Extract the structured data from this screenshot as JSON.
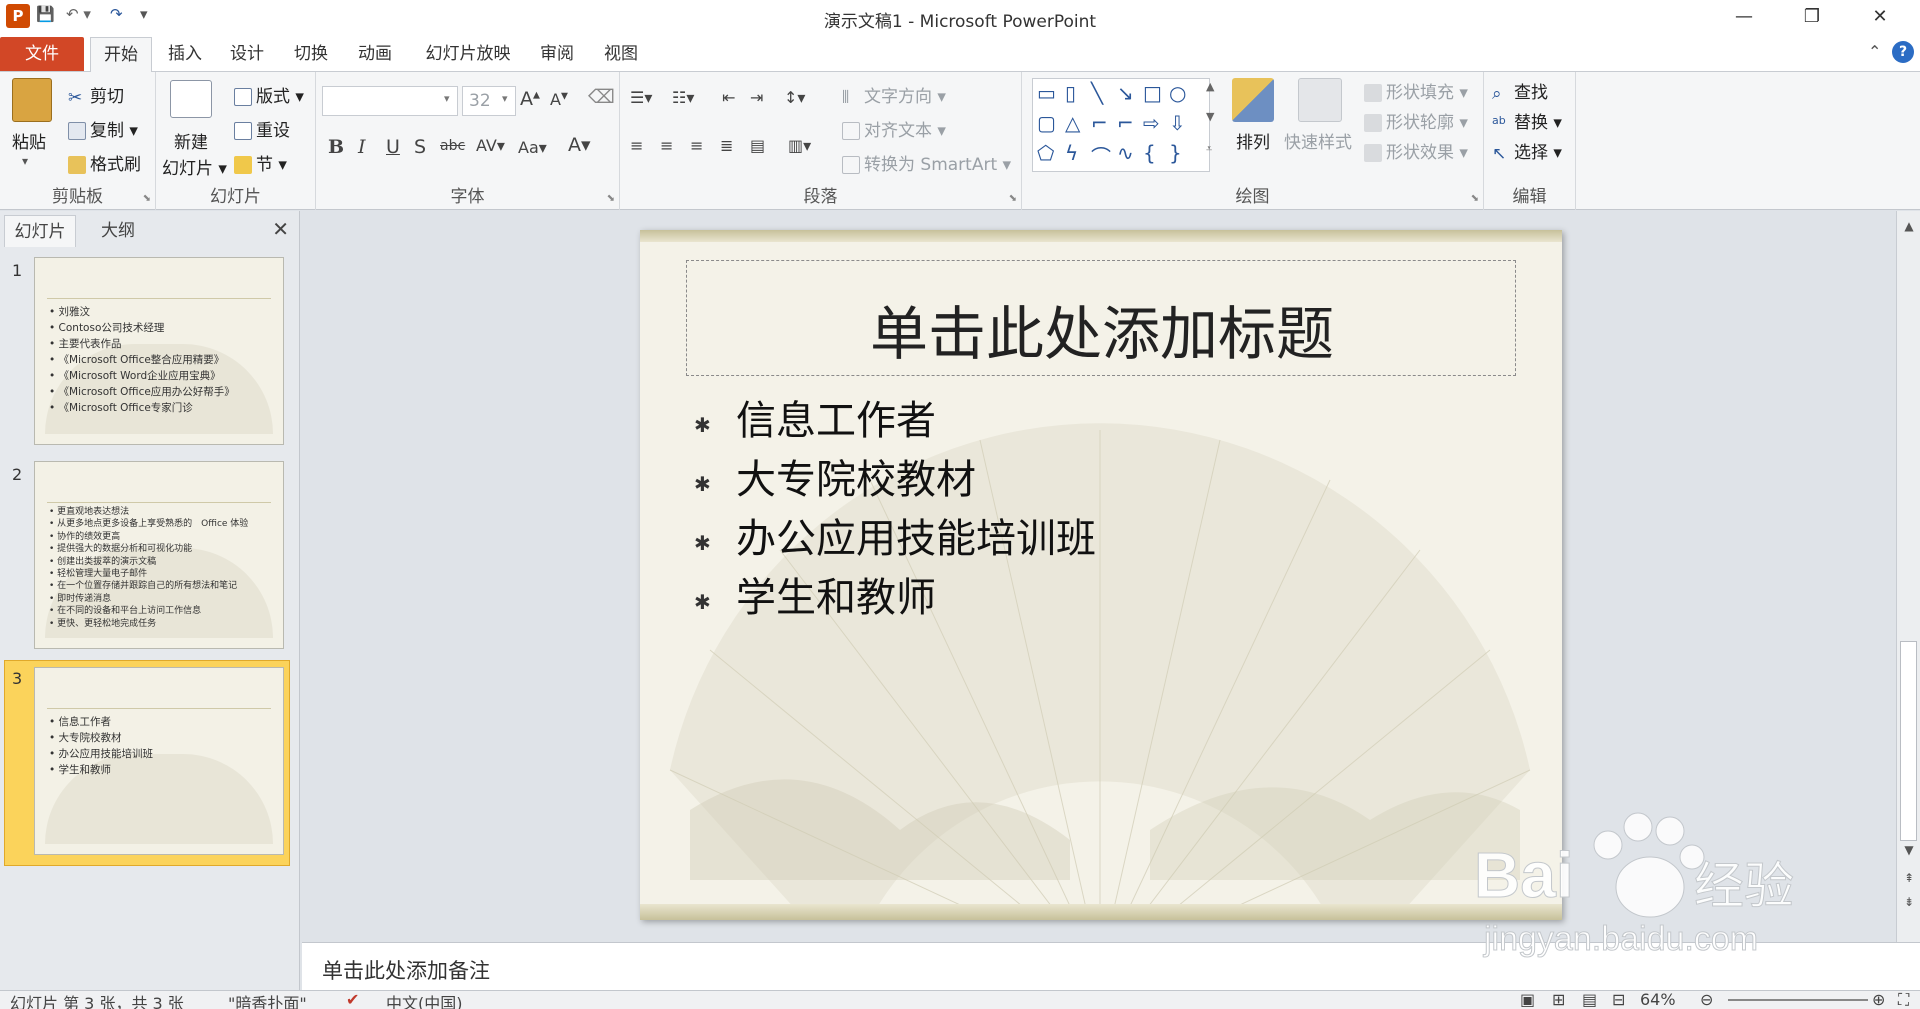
{
  "window": {
    "title": "演示文稿1 - Microsoft PowerPoint",
    "app_icon": "P"
  },
  "tabs": {
    "file": "文件",
    "items": [
      "开始",
      "插入",
      "设计",
      "切换",
      "动画",
      "幻灯片放映",
      "审阅",
      "视图"
    ],
    "active": "开始"
  },
  "ribbon": {
    "clipboard": {
      "paste": "粘贴",
      "cut": "剪切",
      "copy": "复制",
      "format_painter": "格式刷",
      "label": "剪贴板"
    },
    "slides": {
      "new_slide_1": "新建",
      "new_slide_2": "幻灯片",
      "layout": "版式",
      "reset": "重设",
      "section": "节",
      "label": "幻灯片"
    },
    "font": {
      "font_name": "",
      "font_size": "32",
      "label": "字体"
    },
    "paragraph": {
      "text_direction": "文字方向",
      "align_text": "对齐文本",
      "convert_smartart": "转换为 SmartArt",
      "label": "段落"
    },
    "drawing": {
      "arrange": "排列",
      "quick_styles": "快速样式",
      "shape_fill": "形状填充",
      "shape_outline": "形状轮廓",
      "shape_effects": "形状效果",
      "label": "绘图"
    },
    "editing": {
      "find": "查找",
      "replace": "替换",
      "select": "选择",
      "label": "编辑"
    }
  },
  "left_pane": {
    "tab_slides": "幻灯片",
    "tab_outline": "大纲",
    "thumbnails": [
      {
        "number": "1",
        "bullets": [
          "刘雅汶",
          "Contoso公司技术经理",
          "主要代表作品",
          "《Microsoft Office整合应用精要》",
          "《Microsoft Word企业应用宝典》",
          "《Microsoft Office应用办公好帮手》",
          "《Microsoft Office专家门诊"
        ]
      },
      {
        "number": "2",
        "bullets": [
          "更直观地表达想法",
          "从更多地点更多设备上享受熟悉的　Office 体验",
          "协作的绩效更高",
          "提供强大的数据分析和可视化功能",
          "创建出类拔萃的演示文稿",
          "轻松管理大量电子邮件",
          "在一个位置存储并跟踪自己的所有想法和笔记",
          "即时传递消息",
          "在不同的设备和平台上访问工作信息",
          "更快、更轻松地完成任务"
        ]
      },
      {
        "number": "3",
        "bullets": [
          "信息工作者",
          "大专院校教材",
          "办公应用技能培训班",
          "学生和教师"
        ]
      }
    ]
  },
  "slide": {
    "title_placeholder": "单击此处添加标题",
    "bullets": [
      "信息工作者",
      "大专院校教材",
      "办公应用技能培训班",
      "学生和教师"
    ]
  },
  "notes": {
    "placeholder": "单击此处添加备注"
  },
  "statusbar": {
    "slide_info": "幻灯片 第 3 张，共 3 张",
    "theme": "\"暗香扑面\"",
    "language": "中文(中国)",
    "zoom": "64%"
  },
  "watermark": {
    "brand": "Bai",
    "brand2": "经验",
    "url": "jingyan.baidu.com"
  }
}
